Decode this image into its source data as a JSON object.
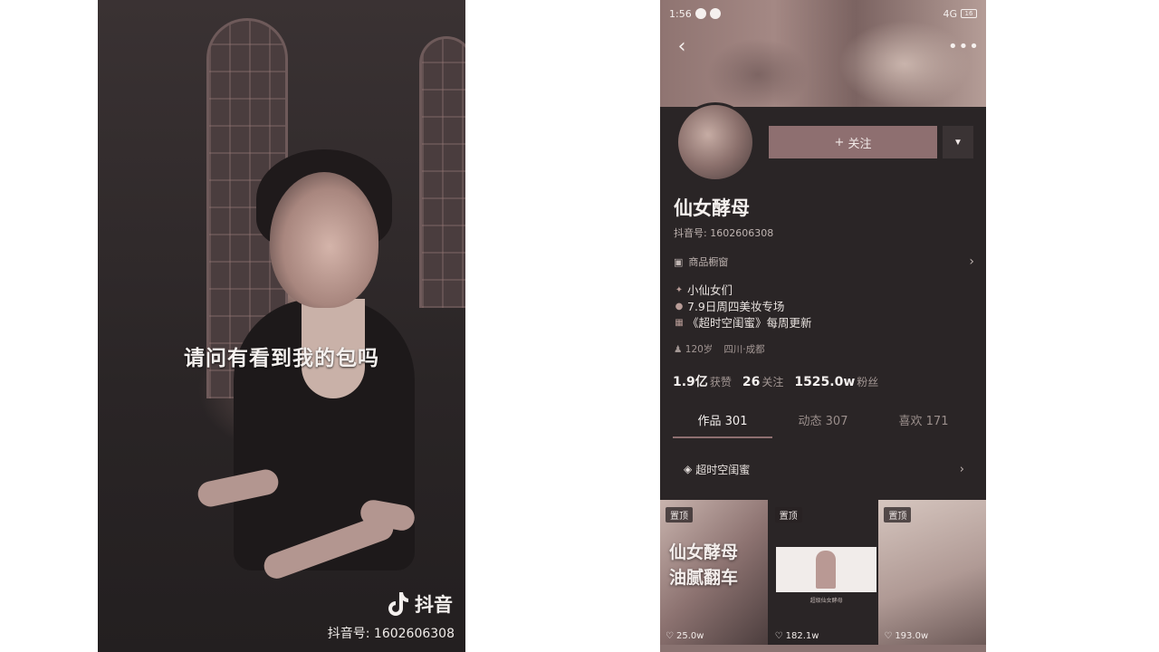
{
  "video": {
    "subtitle": "请问有看到我的包吗",
    "logo_text": "抖音",
    "douyin_id": "抖音号: 1602606308"
  },
  "profile": {
    "status": {
      "time": "1:56",
      "network": "4G",
      "battery": "16"
    },
    "follow_label": "关注",
    "follow_plus": "+",
    "name": "仙女酵母",
    "douyin_id": "抖音号: 1602606308",
    "shop_label": "商品橱窗",
    "bio": [
      {
        "icon": "✦",
        "text": "小仙女们"
      },
      {
        "icon": "●",
        "text": "7.9日周四美妆专场"
      },
      {
        "icon": "▦",
        "text": "《超时空闺蜜》每周更新"
      }
    ],
    "age": "120岁",
    "location": "四川·成都",
    "stats": [
      {
        "value": "1.9亿",
        "label": "获赞"
      },
      {
        "value": "26",
        "label": "关注"
      },
      {
        "value": "1525.0w",
        "label": "粉丝"
      }
    ],
    "tabs": [
      {
        "label": "作品 301",
        "active": true
      },
      {
        "label": "动态 307",
        "active": false
      },
      {
        "label": "喜欢 171",
        "active": false
      }
    ],
    "collection_label": "超时空闺蜜",
    "posts": [
      {
        "pin": "置顶",
        "title_line1": "仙女酵母",
        "title_line2": "油腻翻车",
        "likes": "25.0w"
      },
      {
        "pin": "置顶",
        "caption": "超级仙女酵母",
        "likes": "182.1w"
      },
      {
        "pin": "置顶",
        "likes": "193.0w"
      }
    ]
  },
  "colors": {
    "background": "#2a2526",
    "accent": "#8e6f70"
  }
}
